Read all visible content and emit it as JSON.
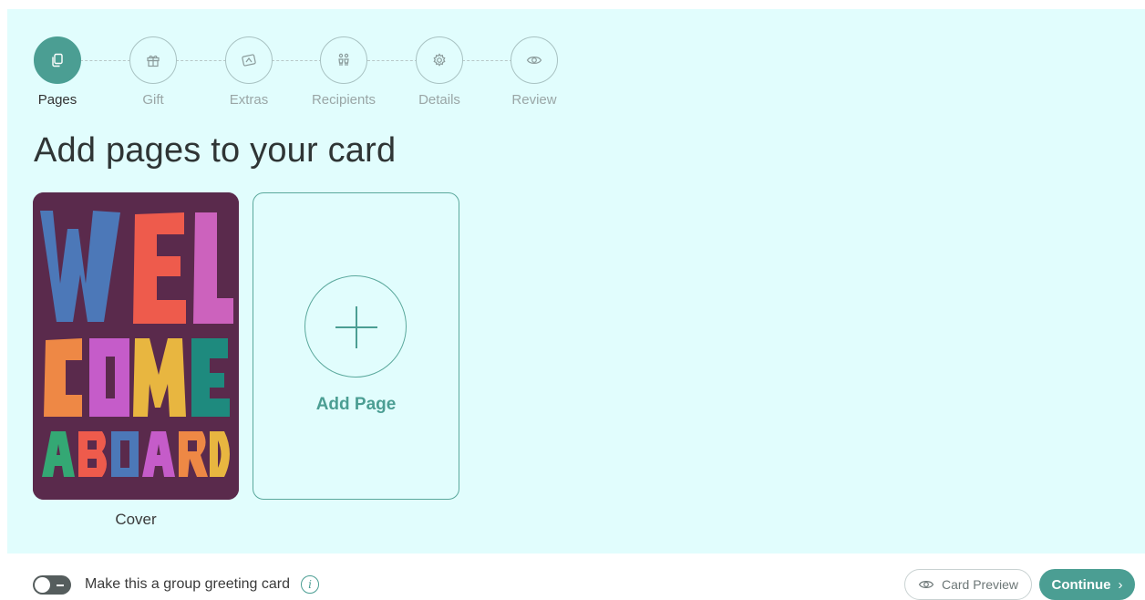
{
  "stepper": {
    "steps": [
      {
        "label": "Pages",
        "icon": "pages-icon",
        "active": true
      },
      {
        "label": "Gift",
        "icon": "gift-icon",
        "active": false
      },
      {
        "label": "Extras",
        "icon": "extras-icon",
        "active": false
      },
      {
        "label": "Recipients",
        "icon": "recipients-icon",
        "active": false
      },
      {
        "label": "Details",
        "icon": "details-gear-icon",
        "active": false
      },
      {
        "label": "Review",
        "icon": "eye-icon",
        "active": false
      }
    ]
  },
  "main": {
    "title": "Add pages to your card",
    "cover": {
      "label": "Cover",
      "artwork_text": [
        "WEL",
        "COME",
        "ABOARD"
      ]
    },
    "add_page": {
      "label": "Add Page"
    }
  },
  "footer": {
    "group_toggle_label": "Make this a group greeting card",
    "info_icon": "i",
    "preview_label": "Card Preview",
    "continue_label": "Continue",
    "continue_chevron": "›"
  },
  "colors": {
    "accent": "#4b9e93",
    "panel_bg": "#e1fdfd",
    "cover_bg": "#5a2a4c"
  }
}
